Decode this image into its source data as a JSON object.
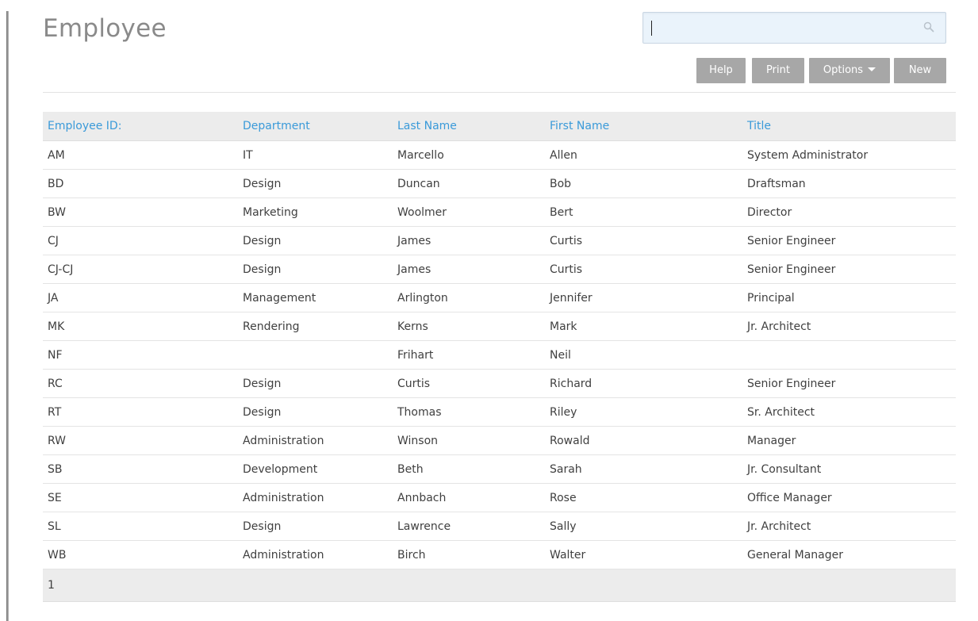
{
  "page": {
    "title": "Employee"
  },
  "search": {
    "value": "",
    "placeholder": ""
  },
  "toolbar": {
    "help_label": "Help",
    "print_label": "Print",
    "options_label": "Options",
    "new_label": "New"
  },
  "table": {
    "columns": [
      "Employee ID:",
      "Department",
      "Last Name",
      "First Name",
      "Title"
    ],
    "rows": [
      [
        "AM",
        "IT",
        "Marcello",
        "Allen",
        "System Administrator"
      ],
      [
        "BD",
        "Design",
        "Duncan",
        "Bob",
        "Draftsman"
      ],
      [
        "BW",
        "Marketing",
        "Woolmer",
        "Bert",
        "Director"
      ],
      [
        "CJ",
        "Design",
        "James",
        "Curtis",
        "Senior Engineer"
      ],
      [
        "CJ-CJ",
        "Design",
        "James",
        "Curtis",
        "Senior Engineer"
      ],
      [
        "JA",
        "Management",
        "Arlington",
        "Jennifer",
        "Principal"
      ],
      [
        "MK",
        "Rendering",
        "Kerns",
        "Mark",
        "Jr. Architect"
      ],
      [
        "NF",
        "",
        "Frihart",
        "Neil",
        ""
      ],
      [
        "RC",
        "Design",
        "Curtis",
        "Richard",
        "Senior Engineer"
      ],
      [
        "RT",
        "Design",
        "Thomas",
        "Riley",
        "Sr. Architect"
      ],
      [
        "RW",
        "Administration",
        "Winson",
        "Rowald",
        "Manager"
      ],
      [
        "SB",
        "Development",
        "Beth",
        "Sarah",
        "Jr. Consultant"
      ],
      [
        "SE",
        "Administration",
        "Annbach",
        "Rose",
        "Office Manager"
      ],
      [
        "SL",
        "Design",
        "Lawrence",
        "Sally",
        "Jr. Architect"
      ],
      [
        "WB",
        "Administration",
        "Birch",
        "Walter",
        "General Manager"
      ]
    ],
    "pager": "1"
  },
  "colors": {
    "header_link": "#3a9ad9",
    "button_bg": "#a7a7a7",
    "title_text": "#8a8a8a",
    "search_bg": "#eaf3fb"
  },
  "icons": {
    "search": "search-icon",
    "options_dropdown": "caret-down-icon"
  }
}
